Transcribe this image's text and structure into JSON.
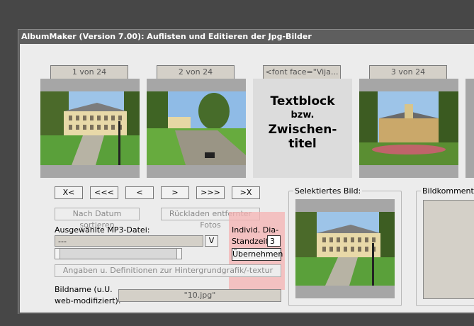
{
  "window": {
    "title": "AlbumMaker (Version 7.00): Auflisten und Editieren der Jpg-Bilder"
  },
  "thumbnails": [
    {
      "caption": "1 von 24"
    },
    {
      "caption": "2 von 24"
    },
    {
      "caption": "<font face=\"Vija..."
    },
    {
      "caption": "3 von 24"
    }
  ],
  "textblock": {
    "line1": "Textblock",
    "line2": "bzw.",
    "line3": "Zwischen-",
    "line4": "titel"
  },
  "nav": {
    "first": "X<",
    "back_many": "<<<",
    "back": "<",
    "forward": ">",
    "forward_many": ">>>",
    "last": ">X"
  },
  "sort_date_label": "Nach Datum sortieren",
  "reload_label": "Rückladen entfernter Fotos",
  "mp3": {
    "label": "Ausgewählte MP3-Datei:",
    "value": "---",
    "dropdown_glyph": "V"
  },
  "dia": {
    "label_line1": "Individ.  Dia-",
    "label_line2": "Standzeit:",
    "value": "3",
    "apply_label": "Übernehmen"
  },
  "background_defs_label": "Angaben u. Definitionen zur Hintergrundgrafik/-textur",
  "filename": {
    "label_line1": "Bildname (u.U.",
    "label_line2": "web-modifiziert):",
    "value": "\"10.jpg\""
  },
  "selected_label": "Selektiertes Bild:",
  "comment_label": "Bildkommentar b"
}
